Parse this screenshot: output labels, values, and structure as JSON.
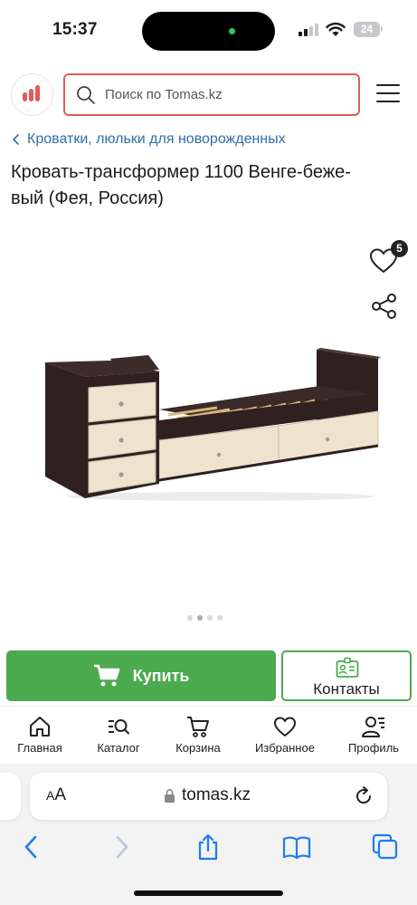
{
  "status_bar": {
    "time": "15:37",
    "battery": "24",
    "island_dot_color": "#34c759"
  },
  "header": {
    "logo_icon": "tomas-logo-icon",
    "brand_color": "#e25b5b",
    "search": {
      "placeholder": "Поиск по Tomas.kz",
      "value": ""
    },
    "menu_icon": "hamburger-icon"
  },
  "breadcrumb": {
    "label": "Кроватки, люльки для новорожденных",
    "color": "#2f6fa8"
  },
  "product": {
    "title_line1": "Кровать-трансформер 1100 Венге-беже-",
    "title_line2": "вый (Фея, Россия)",
    "favorites_count": "5",
    "gallery": {
      "total": 4,
      "active_index": 1
    }
  },
  "actions": {
    "buy_label": "Купить",
    "contacts_label": "Контакты",
    "accent_color": "#4caa4f"
  },
  "bottom_nav": {
    "items": [
      {
        "label": "Главная",
        "icon": "home-icon"
      },
      {
        "label": "Каталог",
        "icon": "catalog-search-icon"
      },
      {
        "label": "Корзина",
        "icon": "cart-icon"
      },
      {
        "label": "Избранное",
        "icon": "heart-icon"
      },
      {
        "label": "Профиль",
        "icon": "profile-icon"
      }
    ]
  },
  "browser": {
    "aa_label_small": "A",
    "aa_label_large": "A",
    "url": "tomas.kz"
  }
}
